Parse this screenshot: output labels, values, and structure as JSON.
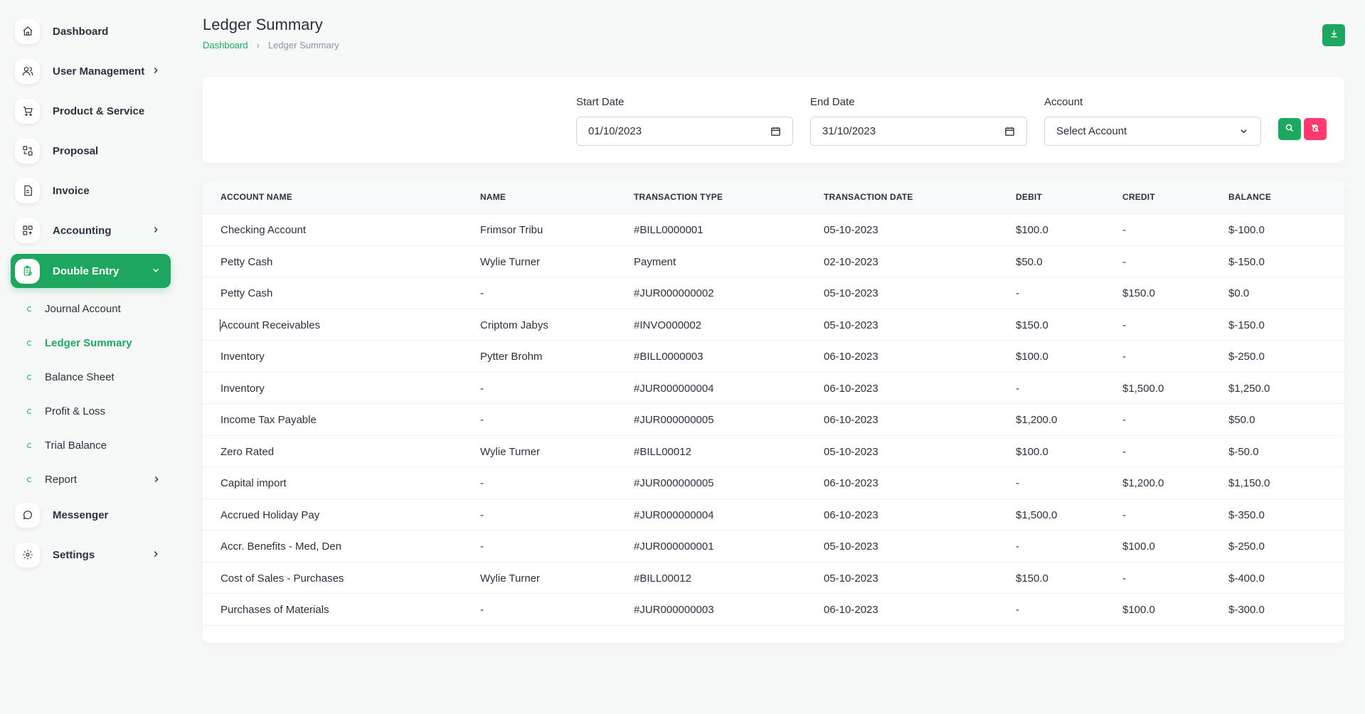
{
  "sidebar": {
    "items": [
      {
        "label": "Dashboard",
        "icon": "home-icon"
      },
      {
        "label": "User Management",
        "icon": "users-icon",
        "has_arrow": true
      },
      {
        "label": "Product & Service",
        "icon": "cart-icon"
      },
      {
        "label": "Proposal",
        "icon": "proposal-icon"
      },
      {
        "label": "Invoice",
        "icon": "invoice-icon"
      },
      {
        "label": "Accounting",
        "icon": "accounting-icon",
        "has_arrow": true
      },
      {
        "label": "Double Entry",
        "icon": "double-entry-icon",
        "active": true,
        "expanded": true
      }
    ],
    "subitems": [
      {
        "label": "Journal Account"
      },
      {
        "label": "Ledger Summary",
        "active": true
      },
      {
        "label": "Balance Sheet"
      },
      {
        "label": "Profit & Loss"
      },
      {
        "label": "Trial Balance"
      },
      {
        "label": "Report",
        "has_arrow": true
      }
    ],
    "bottom_items": [
      {
        "label": "Messenger",
        "icon": "messenger-icon"
      },
      {
        "label": "Settings",
        "icon": "settings-icon",
        "has_arrow": true
      }
    ]
  },
  "header": {
    "title": "Ledger Summary",
    "breadcrumb": {
      "home": "Dashboard",
      "current": "Ledger Summary"
    },
    "export_icon": "download-icon"
  },
  "filters": {
    "start_date": {
      "label": "Start Date",
      "value": "01/10/2023"
    },
    "end_date": {
      "label": "End Date",
      "value": "31/10/2023"
    },
    "account": {
      "label": "Account",
      "value": "Select Account"
    }
  },
  "table": {
    "columns": [
      "ACCOUNT NAME",
      "NAME",
      "TRANSACTION TYPE",
      "TRANSACTION DATE",
      "DEBIT",
      "CREDIT",
      "BALANCE"
    ],
    "rows": [
      [
        "Checking Account",
        "Frimsor Tribu",
        "#BILL0000001",
        "05-10-2023",
        "$100.0",
        "-",
        "$-100.0"
      ],
      [
        "Petty Cash",
        "Wylie Turner",
        "Payment",
        "02-10-2023",
        "$50.0",
        "-",
        "$-150.0"
      ],
      [
        "Petty Cash",
        "-",
        "#JUR000000002",
        "05-10-2023",
        "-",
        "$150.0",
        "$0.0"
      ],
      [
        "Account Receivables",
        "Criptom Jabys",
        "#INVO000002",
        "05-10-2023",
        "$150.0",
        "-",
        "$-150.0"
      ],
      [
        "Inventory",
        "Pytter Brohm",
        "#BILL0000003",
        "06-10-2023",
        "$100.0",
        "-",
        "$-250.0"
      ],
      [
        "Inventory",
        "-",
        "#JUR000000004",
        "06-10-2023",
        "-",
        "$1,500.0",
        "$1,250.0"
      ],
      [
        "Income Tax Payable",
        "-",
        "#JUR000000005",
        "06-10-2023",
        "$1,200.0",
        "-",
        "$50.0"
      ],
      [
        "Zero Rated",
        "Wylie Turner",
        "#BILL00012",
        "05-10-2023",
        "$100.0",
        "-",
        "$-50.0"
      ],
      [
        "Capital import",
        "-",
        "#JUR000000005",
        "06-10-2023",
        "-",
        "$1,200.0",
        "$1,150.0"
      ],
      [
        "Accrued Holiday Pay",
        "-",
        "#JUR000000004",
        "06-10-2023",
        "$1,500.0",
        "-",
        "$-350.0"
      ],
      [
        "Accr. Benefits - Med, Den",
        "-",
        "#JUR000000001",
        "05-10-2023",
        "-",
        "$100.0",
        "$-250.0"
      ],
      [
        "Cost of Sales - Purchases",
        "Wylie Turner",
        "#BILL00012",
        "05-10-2023",
        "$150.0",
        "-",
        "$-400.0"
      ],
      [
        "Purchases of Materials",
        "-",
        "#JUR000000003",
        "06-10-2023",
        "-",
        "$100.0",
        "$-300.0"
      ]
    ]
  },
  "colors": {
    "accent": "#1ea85f",
    "danger": "#ff3a6e",
    "text": "#293240",
    "muted": "#8a94a6"
  }
}
